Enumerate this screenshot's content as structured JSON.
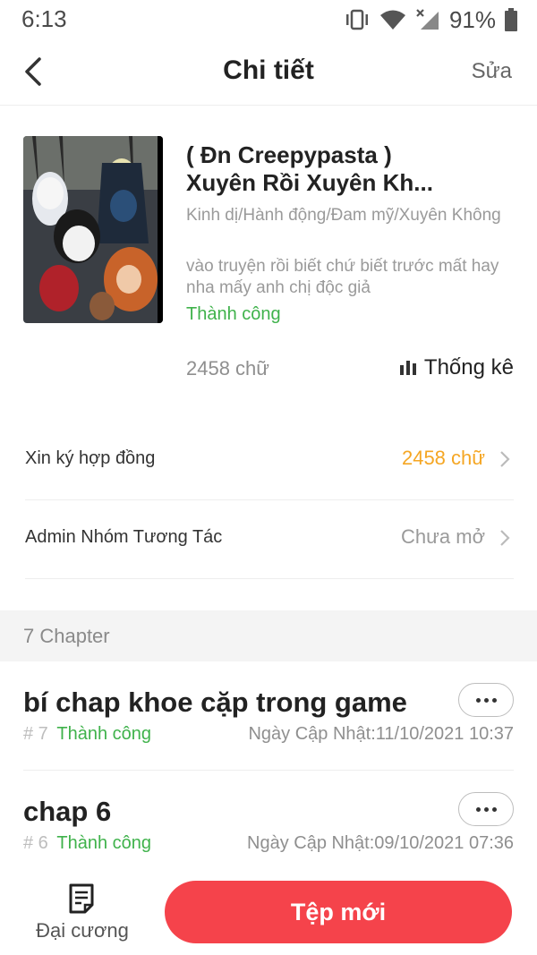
{
  "status_bar": {
    "time": "6:13",
    "battery_percent": "91%",
    "icons": [
      "vibrate-icon",
      "wifi-icon",
      "signal-icon",
      "battery-icon"
    ]
  },
  "nav": {
    "title": "Chi tiết",
    "edit_label": "Sửa",
    "back_icon": "chevron-left-icon"
  },
  "book": {
    "title_line1": "( Đn Creepypasta )",
    "title_line2": "Xuyên Rồi Xuyên Kh...",
    "genres": "Kinh dị/Hành động/Đam mỹ/Xuyên Không",
    "description": "vào truyện rồi biết chứ biết trước mất hay nha mấy anh chị độc giả",
    "status": "Thành công",
    "word_count": "2458 chữ",
    "stats_label": "Thống kê"
  },
  "rows": [
    {
      "label": "Xin ký hợp đồng",
      "value": "2458 chữ",
      "value_color": "#f5a623"
    },
    {
      "label": "Admin Nhóm Tương Tác",
      "value": "Chưa mở",
      "value_color": "#9a9a9a"
    }
  ],
  "chapters_header": "7 Chapter",
  "chapters": [
    {
      "title": "bí chap khoe cặp trong game",
      "number": "# 7",
      "status": "Thành công",
      "updated": "Ngày Cập Nhật:11/10/2021 10:37"
    },
    {
      "title": "chap 6",
      "number": "# 6",
      "status": "Thành công",
      "updated": "Ngày Cập Nhật:09/10/2021 07:36"
    }
  ],
  "bottom": {
    "outline_label": "Đại cương",
    "new_button_label": "Tệp mới"
  },
  "colors": {
    "accent_red": "#f5434b",
    "success_green": "#3fb24b",
    "orange": "#f5a623"
  }
}
